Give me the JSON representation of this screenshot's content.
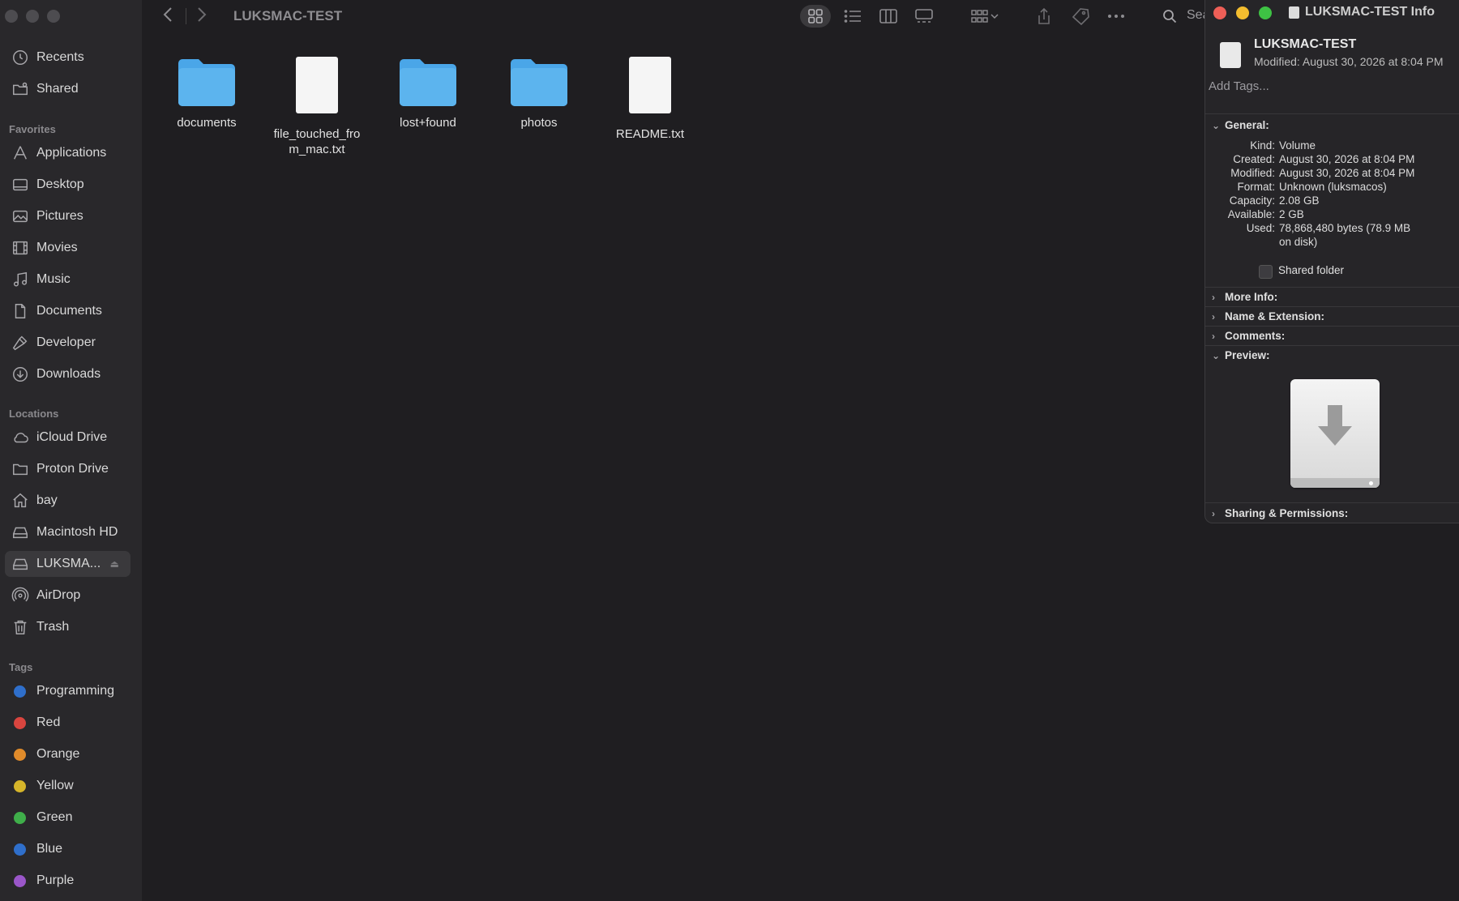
{
  "window": {
    "title": "LUKSMAC-TEST",
    "search_label": "Sea"
  },
  "sidebar": {
    "top": [
      {
        "label": "Recents",
        "icon": "clock-icon"
      },
      {
        "label": "Shared",
        "icon": "shared-folder-icon"
      }
    ],
    "favorites_heading": "Favorites",
    "favorites": [
      {
        "label": "Applications",
        "icon": "applications-icon"
      },
      {
        "label": "Desktop",
        "icon": "desktop-icon"
      },
      {
        "label": "Pictures",
        "icon": "pictures-icon"
      },
      {
        "label": "Movies",
        "icon": "film-icon"
      },
      {
        "label": "Music",
        "icon": "music-note-icon"
      },
      {
        "label": "Documents",
        "icon": "document-icon"
      },
      {
        "label": "Developer",
        "icon": "hammer-icon"
      },
      {
        "label": "Downloads",
        "icon": "download-icon"
      }
    ],
    "locations_heading": "Locations",
    "locations": [
      {
        "label": "iCloud Drive",
        "icon": "cloud-icon"
      },
      {
        "label": "Proton Drive",
        "icon": "folder-icon"
      },
      {
        "label": "bay",
        "icon": "home-icon"
      },
      {
        "label": "Macintosh HD",
        "icon": "drive-icon"
      },
      {
        "label": "LUKSMA...",
        "icon": "drive-icon",
        "selected": true,
        "eject": "⏏"
      },
      {
        "label": "AirDrop",
        "icon": "airdrop-icon"
      },
      {
        "label": "Trash",
        "icon": "trash-icon"
      }
    ],
    "tags_heading": "Tags",
    "tags": [
      {
        "label": "Programming",
        "color": "#2f6fcb"
      },
      {
        "label": "Red",
        "color": "#d9453f"
      },
      {
        "label": "Orange",
        "color": "#e08b2b"
      },
      {
        "label": "Yellow",
        "color": "#d6b52a"
      },
      {
        "label": "Green",
        "color": "#3fae4a"
      },
      {
        "label": "Blue",
        "color": "#2f6fcb"
      },
      {
        "label": "Purple",
        "color": "#9a56c9"
      }
    ]
  },
  "files": [
    {
      "name": "documents",
      "kind": "folder"
    },
    {
      "name": "file_touched_from_mac.txt",
      "kind": "text"
    },
    {
      "name": "lost+found",
      "kind": "folder"
    },
    {
      "name": "photos",
      "kind": "folder"
    },
    {
      "name": "README.txt",
      "kind": "text"
    }
  ],
  "info": {
    "title": "LUKSMAC-TEST Info",
    "name": "LUKSMAC-TEST",
    "modified_header": "Modified: August 30, 2026 at 8:04 PM",
    "tags_placeholder": "Add Tags...",
    "general_label": "General:",
    "general": [
      {
        "k": "Kind:",
        "v": "Volume"
      },
      {
        "k": "Created:",
        "v": "August 30, 2026 at 8:04 PM"
      },
      {
        "k": "Modified:",
        "v": "August 30, 2026 at 8:04 PM"
      },
      {
        "k": "Format:",
        "v": "Unknown (luksmacos)"
      },
      {
        "k": "Capacity:",
        "v": "2.08 GB"
      },
      {
        "k": "Available:",
        "v": "2 GB"
      },
      {
        "k": "Used:",
        "v": "78,868,480 bytes (78.9 MB",
        "v2": "on disk)"
      }
    ],
    "shared_folder_label": "Shared folder",
    "more_info": "More Info:",
    "name_ext": "Name & Extension:",
    "comments": "Comments:",
    "preview": "Preview:",
    "sharing": "Sharing & Permissions:"
  },
  "colors": {
    "folder": "#5cb4ee",
    "close": "#ee5f57",
    "minimize": "#f4bd2f",
    "zoom": "#3ec244"
  }
}
